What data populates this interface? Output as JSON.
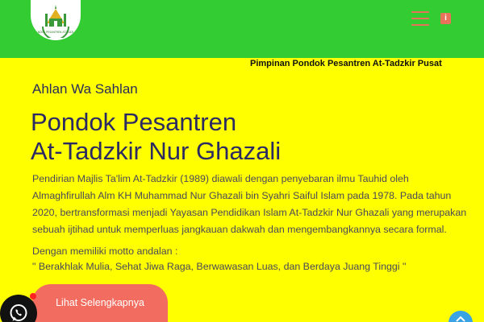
{
  "header": {
    "logo": {
      "icon": "mosque-logo-icon",
      "caption": "PONDOK PESANTREN AT-TADZKIR"
    },
    "menu_icon": "hamburger-menu-icon",
    "info_icon": "info-icon",
    "info_label": "i"
  },
  "marquee": {
    "text": "Pimpinan Pondok Pesantren At-Tadzkir Pusat"
  },
  "hero": {
    "greeting": "Ahlan Wa Sahlan",
    "title_line1": "Pondok Pesantren",
    "title_line2": "At-Tadzkir Nur Ghazali",
    "description": "Pendirian Majlis Ta'lim At-Tadzkir (1989) diawali dengan penyebaran ilmu Tauhid oleh Almaghfirullah Alm KH Muhammad Nur Ghazali bin Syahri Saiful Islam pada 1978. Pada tahun 2020, bertransformasi menjadi Yayasan Pendidikan Islam At-Tadzkir Nur Ghazali yang merupakan sebuah ijtihad untuk memperluas jangkauan dakwah dan mengembangkannya secara formal.",
    "motto_intro": "Dengan memiliki motto andalan :",
    "motto": "\" Berakhlak Mulia, Sehat Jiwa Raga, Berwawasan Luas, dan Berdaya Juang Tinggi \"",
    "cta_label": "Lihat Selengkapnya"
  },
  "floating": {
    "whatsapp_icon": "whatsapp-icon",
    "scroll_top_icon": "arrow-up-icon"
  },
  "colors": {
    "background": "#ffff00",
    "header": "#33cc33",
    "accent": "#f26d5f",
    "title": "#2b2a63",
    "body_text": "#4a4a5a",
    "scroll_button": "#3aa3e3"
  }
}
